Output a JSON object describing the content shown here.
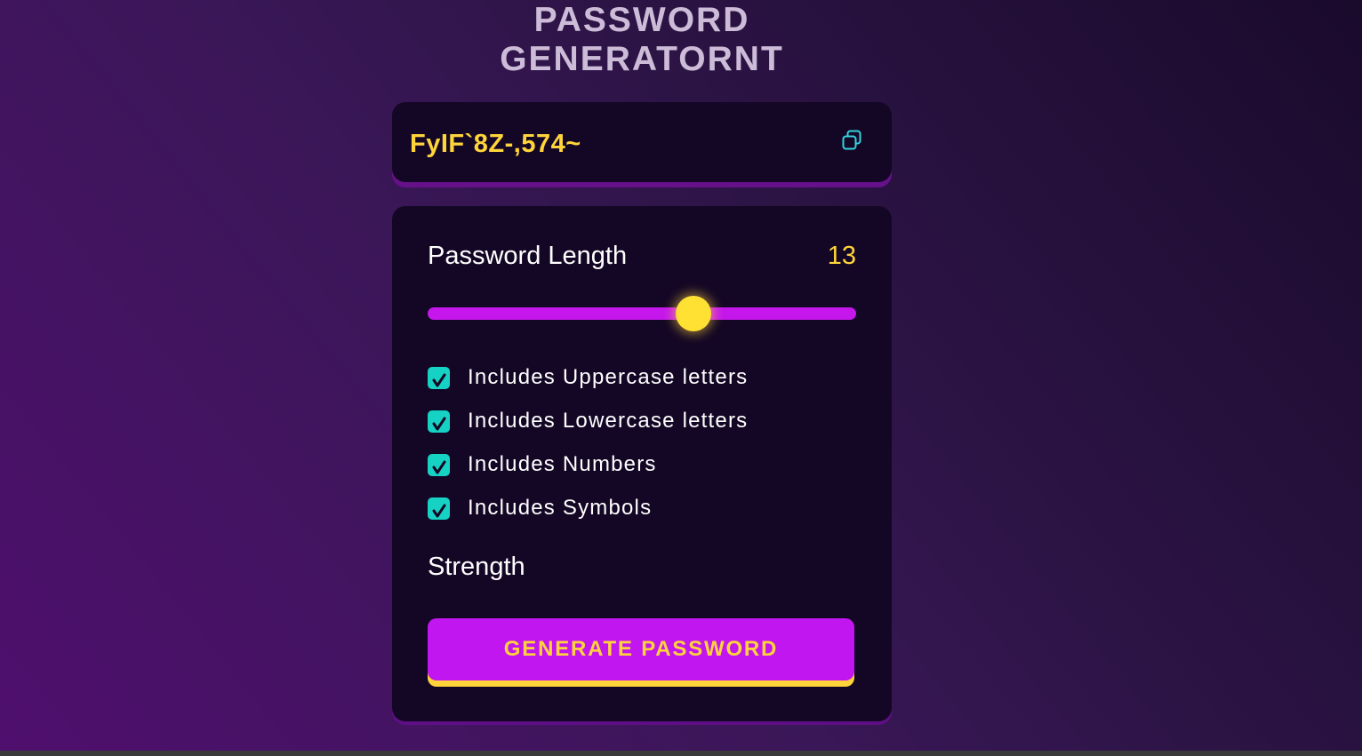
{
  "header": {
    "title_line1": "PASSWORD",
    "title_line2": "GENERATORNT"
  },
  "display": {
    "password": "FyIF`8Z-,574~",
    "copy_icon": "copy-icon"
  },
  "length": {
    "label": "Password Length",
    "value": "13",
    "slider_fraction": 0.62
  },
  "options": [
    {
      "label": "Includes Uppercase letters",
      "checked": true
    },
    {
      "label": "Includes Lowercase letters",
      "checked": true
    },
    {
      "label": "Includes Numbers",
      "checked": true
    },
    {
      "label": "Includes Symbols",
      "checked": true
    }
  ],
  "strength": {
    "label": "Strength"
  },
  "generate": {
    "label": "GENERATE PASSWORD"
  },
  "colors": {
    "accent_yellow": "#ffd43b",
    "accent_purple": "#c116ef",
    "check_teal": "#16d2c4",
    "panel_bg": "#140725"
  }
}
